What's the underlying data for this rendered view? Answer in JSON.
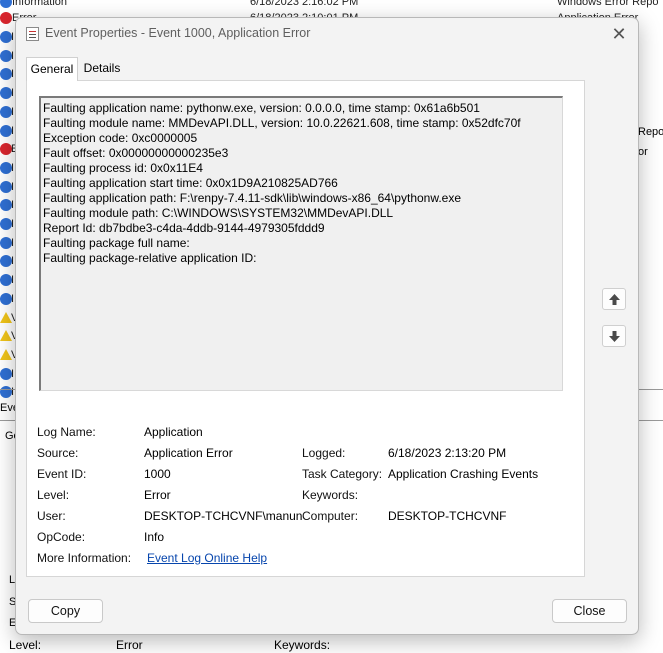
{
  "background": {
    "top_row": {
      "level": "Information",
      "date": "6/18/2023 2:16:02 PM",
      "source": "Windows Error Repo"
    },
    "second_row": {
      "level": "Error",
      "date": "6/18/2023 2:10:01 PM",
      "source": "Application Error"
    },
    "side_texts": [
      "Repo",
      "or"
    ],
    "row_letters": [
      "I",
      "I",
      "I",
      "I",
      "I",
      "I",
      "E",
      "I",
      "I",
      "I",
      "I",
      "I",
      "I",
      "I",
      "I",
      "V",
      "V",
      "V",
      "I",
      "I"
    ],
    "row_kinds": [
      "info",
      "info",
      "info",
      "info",
      "info",
      "info",
      "err",
      "info",
      "info",
      "info",
      "info",
      "info",
      "info",
      "info",
      "info",
      "warn",
      "warn",
      "warn",
      "info",
      "info"
    ],
    "fragments": {
      "ev": "Eve",
      "ge": "Ge",
      "l": "L",
      "s": "S",
      "e": "E"
    },
    "bottom": {
      "level_label": "Level:",
      "level_value": "Error",
      "keywords_label": "Keywords:"
    }
  },
  "dialog": {
    "title": "Event Properties - Event 1000, Application Error",
    "close_glyph": "✕",
    "tabs": {
      "general": "General",
      "details": "Details"
    },
    "description_lines": [
      "Faulting application name: pythonw.exe, version: 0.0.0.0, time stamp: 0x61a6b501",
      "Faulting module name: MMDevAPI.DLL, version: 10.0.22621.608, time stamp: 0x52dfc70f",
      "Exception code: 0xc0000005",
      "Fault offset: 0x00000000000235e3",
      "Faulting process id: 0x0x11E4",
      "Faulting application start time: 0x0x1D9A210825AD766",
      "Faulting application path: F:\\renpy-7.4.11-sdk\\lib\\windows-x86_64\\pythonw.exe",
      "Faulting module path: C:\\WINDOWS\\SYSTEM32\\MMDevAPI.DLL",
      "Report Id: db7bdbe3-c4da-4ddb-9144-4979305fddd9",
      "Faulting package full name:",
      "Faulting package-relative application ID:"
    ],
    "props": {
      "log_name": {
        "label": "Log Name:",
        "value": "Application"
      },
      "source": {
        "label": "Source:",
        "value": "Application Error"
      },
      "logged": {
        "label": "Logged:",
        "value": "6/18/2023 2:13:20 PM"
      },
      "event_id": {
        "label": "Event ID:",
        "value": "1000"
      },
      "task_category": {
        "label": "Task Category:",
        "value": "Application Crashing Events"
      },
      "level": {
        "label": "Level:",
        "value": "Error"
      },
      "keywords": {
        "label": "Keywords:",
        "value": ""
      },
      "user": {
        "label": "User:",
        "value": "DESKTOP-TCHCVNF\\manun"
      },
      "computer": {
        "label": "Computer:",
        "value": "DESKTOP-TCHCVNF"
      },
      "opcode": {
        "label": "OpCode:",
        "value": "Info"
      },
      "more_info": {
        "label": "More Information:",
        "value": "Event Log Online Help"
      }
    },
    "buttons": {
      "copy": "Copy",
      "close": "Close"
    },
    "icons": {
      "arrow_up": "arrow-up-icon",
      "arrow_down": "arrow-down-icon",
      "app": "event-viewer-icon"
    }
  },
  "colors": {
    "link": "#0645ad",
    "error": "#d8262e",
    "info": "#2f6fd3",
    "warning": "#f0c419"
  }
}
